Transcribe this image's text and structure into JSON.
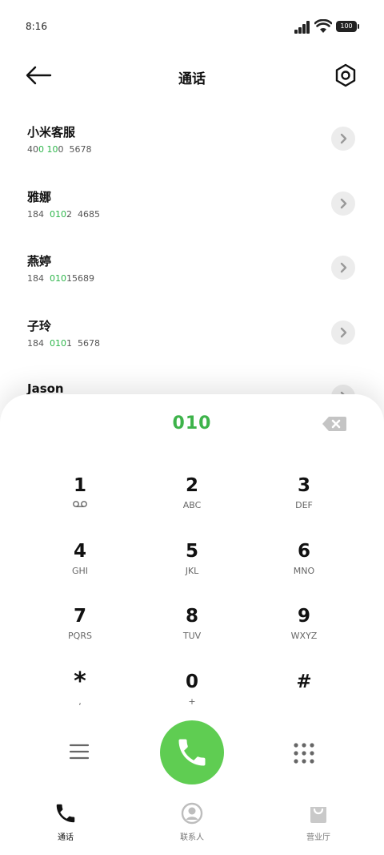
{
  "status": {
    "time": "8:16",
    "battery": "100"
  },
  "header": {
    "title": "通话"
  },
  "contacts": [
    {
      "name": "小米客服",
      "num_pre": "40",
      "num_hl1": "0",
      "num_mid": " ",
      "num_hl2": "10",
      "num_post": "0  5678"
    },
    {
      "name": "雅娜",
      "num_pre": "184  ",
      "num_hl1": "010",
      "num_mid": "",
      "num_hl2": "",
      "num_post": "2  4685"
    },
    {
      "name": "燕婷",
      "num_pre": "184  ",
      "num_hl1": "010",
      "num_mid": "",
      "num_hl2": "",
      "num_post": "15689"
    },
    {
      "name": "子玲",
      "num_pre": "184  ",
      "num_hl1": "010",
      "num_mid": "",
      "num_hl2": "",
      "num_post": "1  5678"
    },
    {
      "name": "Jason",
      "num_pre": "",
      "num_hl1": "",
      "num_mid": "",
      "num_hl2": "",
      "num_post": ""
    }
  ],
  "dialer": {
    "input": "010",
    "keys": [
      {
        "digit": "1",
        "letters": ""
      },
      {
        "digit": "2",
        "letters": "ABC"
      },
      {
        "digit": "3",
        "letters": "DEF"
      },
      {
        "digit": "4",
        "letters": "GHI"
      },
      {
        "digit": "5",
        "letters": "JKL"
      },
      {
        "digit": "6",
        "letters": "MNO"
      },
      {
        "digit": "7",
        "letters": "PQRS"
      },
      {
        "digit": "8",
        "letters": "TUV"
      },
      {
        "digit": "9",
        "letters": "WXYZ"
      },
      {
        "digit": "*",
        "letters": ","
      },
      {
        "digit": "0",
        "letters": "+"
      },
      {
        "digit": "#",
        "letters": ""
      }
    ]
  },
  "tabs": [
    {
      "label": "通话",
      "icon": "phone-icon",
      "active": true
    },
    {
      "label": "联系人",
      "icon": "contacts-icon",
      "active": false
    },
    {
      "label": "营业厅",
      "icon": "shopping-bag-icon",
      "active": false
    }
  ],
  "colors": {
    "accent": "#3db34a",
    "call": "#5fcd52"
  }
}
